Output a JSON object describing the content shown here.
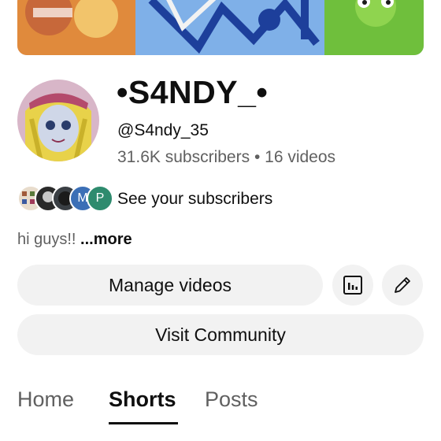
{
  "channel": {
    "name": "•S4NDY_•",
    "handle": "@S4ndy_35",
    "subscribers": "31.6K subscribers",
    "separator": "•",
    "videos": "16 videos"
  },
  "subscribers_row": {
    "label": "See your subscribers",
    "avatars": [
      {
        "letter": "",
        "color": "#e8dccc"
      },
      {
        "letter": "",
        "color": "#2a2a2a"
      },
      {
        "letter": "",
        "color": "#3a3f44"
      },
      {
        "letter": "M",
        "color": "#3b6fb6"
      },
      {
        "letter": "P",
        "color": "#2e8b6e"
      }
    ]
  },
  "description": {
    "text": "hi guys!! ",
    "more_label": "...more"
  },
  "actions": {
    "manage_videos": "Manage videos",
    "visit_community": "Visit Community",
    "analytics_icon": "analytics-icon",
    "edit_icon": "pencil-icon"
  },
  "tabs": [
    {
      "label": "Home",
      "active": false
    },
    {
      "label": "Shorts",
      "active": true
    },
    {
      "label": "Posts",
      "active": false
    }
  ],
  "colors": {
    "text_primary": "#0f0f0f",
    "text_secondary": "#606060",
    "button_bg": "#f2f2f2"
  }
}
